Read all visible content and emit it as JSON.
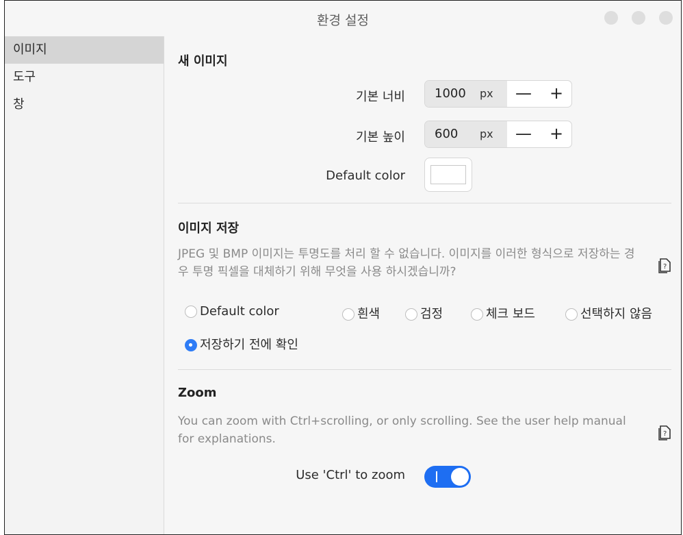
{
  "window": {
    "title": "환경 설정"
  },
  "sidebar": {
    "items": [
      {
        "label": "이미지",
        "active": true
      },
      {
        "label": "도구",
        "active": false
      },
      {
        "label": "창",
        "active": false
      }
    ]
  },
  "new_image": {
    "title": "새 이미지",
    "width": {
      "label": "기본 너비",
      "value": "1000",
      "unit": "px",
      "minus": "—",
      "plus": "+"
    },
    "height": {
      "label": "기본 높이",
      "value": "600",
      "unit": "px",
      "minus": "—",
      "plus": "+"
    },
    "color": {
      "label": "Default color",
      "value": "#ffffff"
    }
  },
  "save_image": {
    "title": "이미지 저장",
    "description": "JPEG 및 BMP 이미지는 투명도를 처리 할 수 없습니다. 이미지를 이러한 형식으로 저장하는 경우 투명 픽셀을 대체하기 위해 무엇을 사용 하시겠습니까?",
    "options": [
      {
        "label": "Default color",
        "selected": false
      },
      {
        "label": "흰색",
        "selected": false
      },
      {
        "label": "검정",
        "selected": false
      },
      {
        "label": "체크 보드",
        "selected": false
      },
      {
        "label": "선택하지 않음",
        "selected": false
      },
      {
        "label": "저장하기 전에 확인",
        "selected": true
      }
    ]
  },
  "zoom": {
    "title": "Zoom",
    "description": "You can zoom with Ctrl+scrolling, or only scrolling. See the user help manual for explanations.",
    "ctrl_label": "Use 'Ctrl' to zoom",
    "ctrl_enabled": true
  },
  "colors": {
    "accent": "#1e6ef2",
    "selected_radio": "#2e7cf6"
  }
}
